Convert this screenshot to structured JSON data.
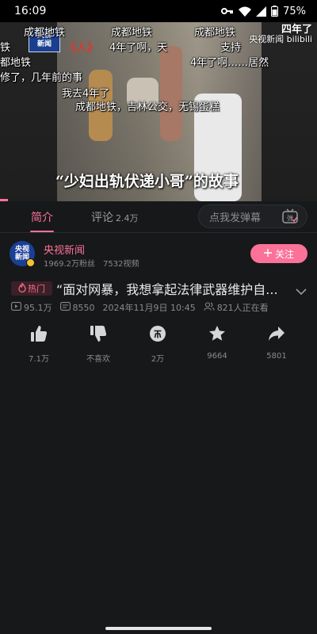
{
  "status_bar": {
    "time": "16:09",
    "battery": "75%"
  },
  "video": {
    "subtitle": "“少妇出轨伏递小哥”的故事",
    "logo_line1": "央视",
    "logo_line2": "新闻",
    "logo_mark": "《人》",
    "watermark_big": "四年了",
    "watermark_small": "央视新闻  bilibili",
    "danmaku": [
      "成都地铁",
      "成都地铁",
      "成都地铁",
      "铁",
      "都地铁",
      "修了，几年前的事",
      "4年了啊，天",
      "支持",
      "4年了啊……居然",
      "我去4年了",
      "成都地铁，吉林公交，无锡蛋糕"
    ]
  },
  "tabs": {
    "intro": "简介",
    "comments": "评论",
    "comments_count": "2.4万",
    "danmaku_placeholder": "点我发弹幕"
  },
  "uploader": {
    "avatar_line1": "央视",
    "avatar_line2": "新闻",
    "name": "央视新闻",
    "followers": "1969.2万粉丝",
    "videos": "7532视频",
    "follow_label": "关注"
  },
  "video_info": {
    "hot_label": "热门",
    "title": "“面对网暴，我想拿起法律武器维护自...",
    "views": "95.1万",
    "danmaku_count": "8550",
    "date": "2024年11月9日 10:45",
    "watching": "821人正在看"
  },
  "actions": {
    "like": "7.1万",
    "dislike": "不喜欢",
    "coin": "2万",
    "favorite": "9664",
    "share": "5801"
  },
  "colors": {
    "accent": "#fb7299",
    "background": "#17181a",
    "muted_text": "#8a8a8a"
  },
  "icons": [
    "key-icon",
    "wifi-icon",
    "signal-icon",
    "battery-icon",
    "tv-danmaku-icon",
    "plus-icon",
    "fire-icon",
    "chevron-down-icon",
    "play-count-icon",
    "danmaku-count-icon",
    "viewers-icon",
    "thumb-up-icon",
    "thumb-down-icon",
    "coin-icon",
    "star-icon",
    "share-icon"
  ]
}
